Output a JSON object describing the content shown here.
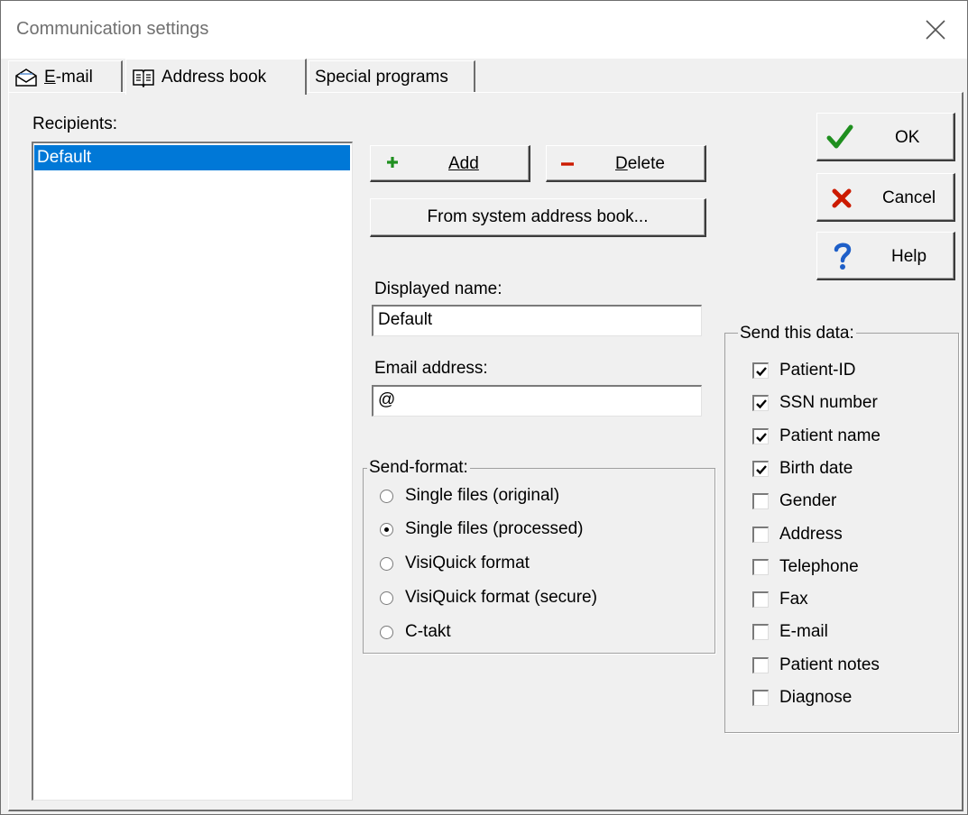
{
  "window": {
    "title": "Communication settings"
  },
  "tabs": [
    {
      "label": "E-mail",
      "icon": "envelope-icon",
      "active": false
    },
    {
      "label": "Address book",
      "icon": "book-icon",
      "active": true
    },
    {
      "label": "Special programs",
      "active": false
    }
  ],
  "recipients": {
    "label": "Recipients:",
    "items": [
      "Default"
    ],
    "selected": "Default"
  },
  "buttons": {
    "add": "Add",
    "delete": "Delete",
    "from_system": "From system address book...",
    "ok": "OK",
    "cancel": "Cancel",
    "help": "Help"
  },
  "displayed_name": {
    "label": "Displayed name:",
    "value": "Default"
  },
  "email_address": {
    "label": "Email address:",
    "value": "@"
  },
  "send_format": {
    "title": "Send-format:",
    "options": [
      "Single files (original)",
      "Single files (processed)",
      "VisiQuick format",
      "VisiQuick format (secure)",
      "C-takt"
    ],
    "selected_index": 1
  },
  "send_data": {
    "title": "Send this data:",
    "items": [
      {
        "label": "Patient-ID",
        "checked": true
      },
      {
        "label": "SSN number",
        "checked": true
      },
      {
        "label": "Patient name",
        "checked": true
      },
      {
        "label": "Birth date",
        "checked": true
      },
      {
        "label": "Gender",
        "checked": false
      },
      {
        "label": "Address",
        "checked": false
      },
      {
        "label": "Telephone",
        "checked": false
      },
      {
        "label": "Fax",
        "checked": false
      },
      {
        "label": "E-mail",
        "checked": false
      },
      {
        "label": "Patient notes",
        "checked": false
      },
      {
        "label": "Diagnose",
        "checked": false
      }
    ]
  },
  "colors": {
    "selection": "#0078d7",
    "ok_check": "#1f8f1f",
    "cancel_x": "#cc1a00",
    "add_plus": "#1f8f1f",
    "delete_minus": "#cc1a00",
    "help_question": "#1e5fc8"
  }
}
